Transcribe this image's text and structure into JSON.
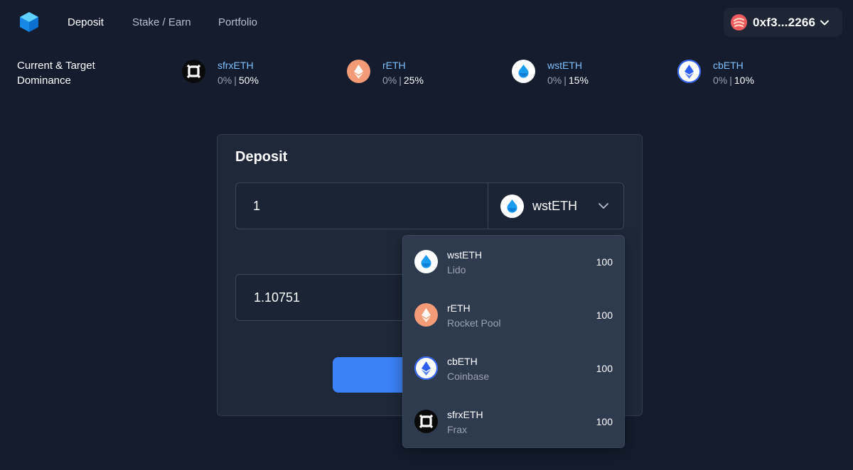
{
  "nav": {
    "links": [
      {
        "label": "Deposit"
      },
      {
        "label": "Stake / Earn"
      },
      {
        "label": "Portfolio"
      }
    ]
  },
  "wallet": {
    "address": "0xf3...2266"
  },
  "dominance": {
    "title_line1": "Current & Target",
    "title_line2": "Dominance",
    "items": [
      {
        "name": "sfrxETH",
        "current": "0%",
        "target": "50%",
        "icon": "sfrxeth-icon"
      },
      {
        "name": "rETH",
        "current": "0%",
        "target": "25%",
        "icon": "reth-icon"
      },
      {
        "name": "wstETH",
        "current": "0%",
        "target": "15%",
        "icon": "wsteth-icon"
      },
      {
        "name": "cbETH",
        "current": "0%",
        "target": "10%",
        "icon": "cbeth-icon"
      }
    ]
  },
  "deposit": {
    "title": "Deposit",
    "amount": "1",
    "selected_token": "wstETH",
    "receive_amount": "1.10751"
  },
  "dropdown": {
    "items": [
      {
        "name": "wstETH",
        "provider": "Lido",
        "value": "100"
      },
      {
        "name": "rETH",
        "provider": "Rocket Pool",
        "value": "100"
      },
      {
        "name": "cbETH",
        "provider": "Coinbase",
        "value": "100"
      },
      {
        "name": "sfrxETH",
        "provider": "Frax",
        "value": "100"
      }
    ]
  },
  "colors": {
    "background": "#141c2d",
    "card": "#1e2839",
    "dropdown": "#2e3a4e",
    "accent_blue": "#3b82f6",
    "link_blue": "#7fc1ff",
    "reth_orange": "#f29b76",
    "wallet_red": "#ef5a5f"
  }
}
